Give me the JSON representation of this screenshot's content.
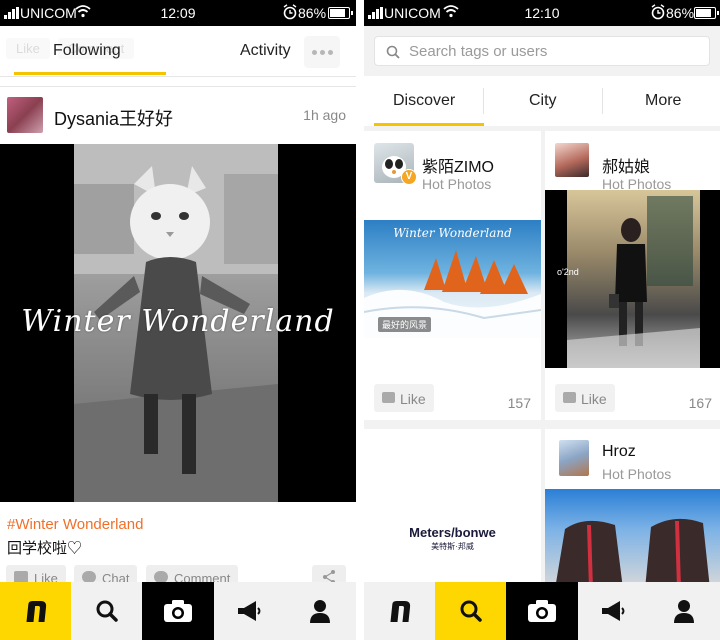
{
  "status_left": {
    "carrier": "UNICOM",
    "time": "12:09",
    "battery": "86%"
  },
  "status_right": {
    "carrier": "UNICOM",
    "time": "12:10",
    "battery": "86%"
  },
  "feed": {
    "tabs": [
      "Following",
      "Activity"
    ],
    "active_tab": "Following",
    "ghost_actions": [
      "Like",
      "Comment"
    ],
    "post": {
      "author": "Dysania王好好",
      "time": "1h ago",
      "image_overlay_text": "Winter Wonderland",
      "tag": "#Winter Wonderland",
      "caption": "回学校啦♡",
      "actions": [
        "Like",
        "Chat",
        "Comment"
      ]
    }
  },
  "discover": {
    "search_placeholder": "Search tags or users",
    "tabs": [
      "Discover",
      "City",
      "More"
    ],
    "active_tab": "Discover",
    "cards": [
      {
        "user": "紫陌ZIMO",
        "category": "Hot Photos",
        "verified": true,
        "photo_title": "Winter Wonderland",
        "photo_tag": "最好的风景",
        "like_label": "Like",
        "likes": "157"
      },
      {
        "user": "郝姑娘",
        "category": "Hot Photos",
        "verified": false,
        "photo_tag": "o'2nd",
        "like_label": "Like",
        "likes": "167"
      },
      {
        "brand": "Meters/bonwe",
        "brand_cn": "美特斯·邦威"
      },
      {
        "user": "Hroz",
        "category": "Hot Photos",
        "verified": false
      }
    ]
  },
  "bottom_nav": [
    {
      "name": "home",
      "icon": "logo-n-icon"
    },
    {
      "name": "search",
      "icon": "search-icon"
    },
    {
      "name": "camera",
      "icon": "camera-icon"
    },
    {
      "name": "announcements",
      "icon": "megaphone-icon"
    },
    {
      "name": "profile",
      "icon": "person-icon"
    }
  ],
  "colors": {
    "accent": "#ffd700",
    "tag_orange": "#f0702a",
    "verified_badge": "#f5a623"
  }
}
